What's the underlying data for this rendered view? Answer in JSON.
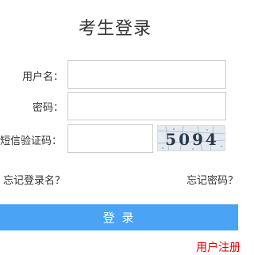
{
  "form": {
    "title": "考生登录",
    "username_label": "用户名：",
    "username_value": "",
    "password_label": "密码：",
    "password_value": "",
    "captcha_label": "短信验证码：",
    "captcha_value": "",
    "captcha_code": "5094"
  },
  "links": {
    "forgot_username": "忘记登录名？",
    "forgot_password": "忘记密码？",
    "register": "用户注册"
  },
  "buttons": {
    "login": "登 录"
  },
  "colors": {
    "login_button": "#4aa3f5",
    "register_link": "#e00000"
  }
}
